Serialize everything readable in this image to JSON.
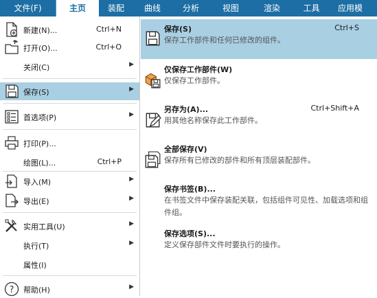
{
  "tabs": {
    "file": "文件(F)",
    "home": "主页",
    "assembly": "装配",
    "curve": "曲线",
    "analysis": "分析",
    "view": "视图",
    "render": "渲染",
    "tools": "工具",
    "apps": "应用模"
  },
  "left_menu": {
    "new": {
      "label": "新建(N)...",
      "shortcut": "Ctrl+N"
    },
    "open": {
      "label": "打开(O)...",
      "shortcut": "Ctrl+O"
    },
    "close": {
      "label": "关闭(C)"
    },
    "save": {
      "label": "保存(S)"
    },
    "preferences": {
      "label": "首选项(P)"
    },
    "print": {
      "label": "打印(P)..."
    },
    "plot": {
      "label": "绘图(L)...",
      "shortcut": "Ctrl+P"
    },
    "import": {
      "label": "导入(M)"
    },
    "export": {
      "label": "导出(E)"
    },
    "utilities": {
      "label": "实用工具(U)"
    },
    "execute": {
      "label": "执行(T)"
    },
    "properties": {
      "label": "属性(I)"
    },
    "help": {
      "label": "帮助(H)"
    }
  },
  "save_submenu": {
    "save": {
      "title": "保存(S)",
      "shortcut": "Ctrl+S",
      "desc": "保存工作部件和任何已修改的组件。"
    },
    "save_work_part_only": {
      "title": "仅保存工作部件(W)",
      "desc": "仅保存工作部件。"
    },
    "save_as": {
      "title": "另存为(A)...",
      "shortcut": "Ctrl+Shift+A",
      "desc": "用其他名称保存此工作部件。"
    },
    "save_all": {
      "title": "全部保存(V)",
      "desc": "保存所有已修改的部件和所有顶层装配部件。"
    },
    "save_bookmark": {
      "title": "保存书签(B)...",
      "desc": "在书签文件中保存装配关联，包括组件可见性、加载选项和组件组。"
    },
    "save_options": {
      "title": "保存选项(S)...",
      "desc": "定义保存部件文件时要执行的操作。"
    }
  },
  "colors": {
    "ribbon": "#1c6ea4",
    "highlight": "#a9cfe3"
  }
}
